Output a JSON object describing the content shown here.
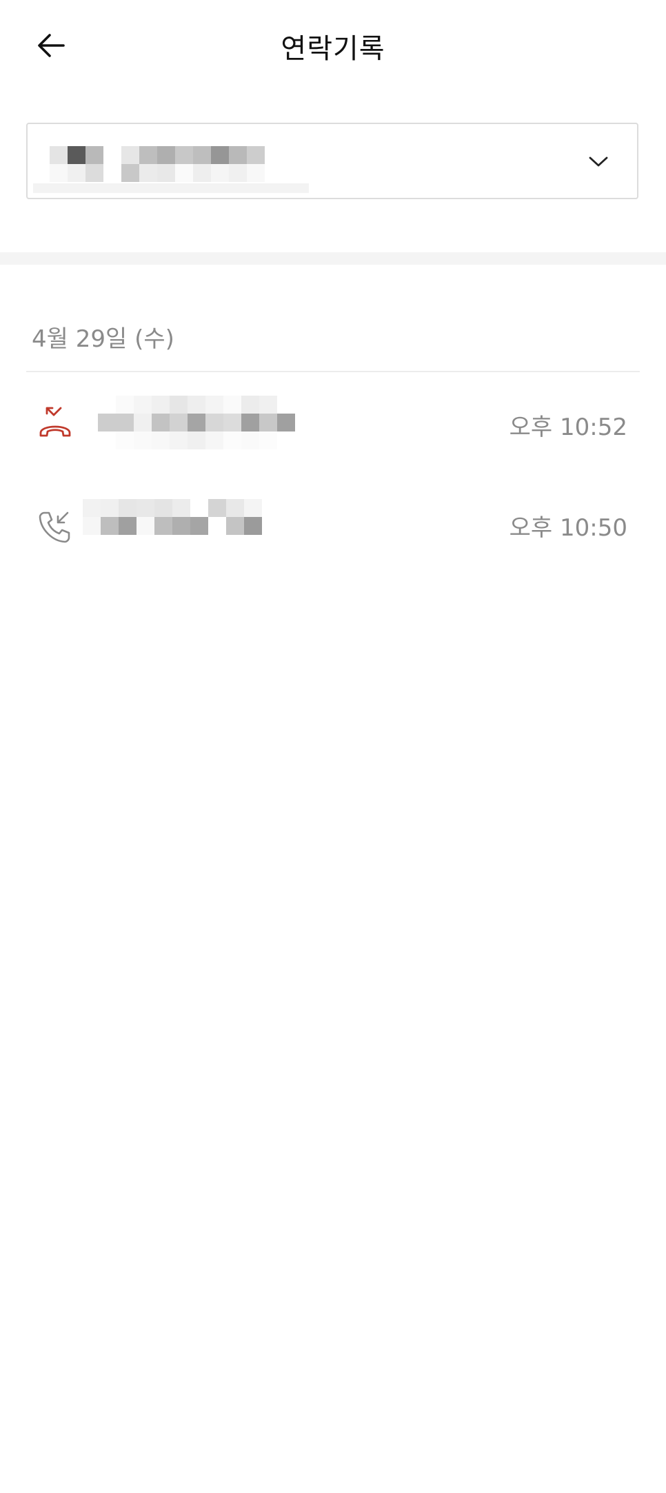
{
  "header": {
    "title": "연락기록",
    "back_icon": "arrow-left-icon"
  },
  "contact_selector": {
    "chevron_icon": "chevron-down-icon"
  },
  "date_group": {
    "date": "4월 29일 (수)"
  },
  "calls": [
    {
      "type": "missed",
      "icon": "missed-call-icon",
      "icon_color": "#c0392b",
      "time": "오후 10:52"
    },
    {
      "type": "incoming",
      "icon": "incoming-call-icon",
      "icon_color": "#8a8a8a",
      "time": "오후 10:50"
    }
  ],
  "colors": {
    "missed": "#c0392b",
    "secondary_text": "#8a8a8a",
    "border": "#dcdcdc",
    "band": "#f4f4f4"
  }
}
